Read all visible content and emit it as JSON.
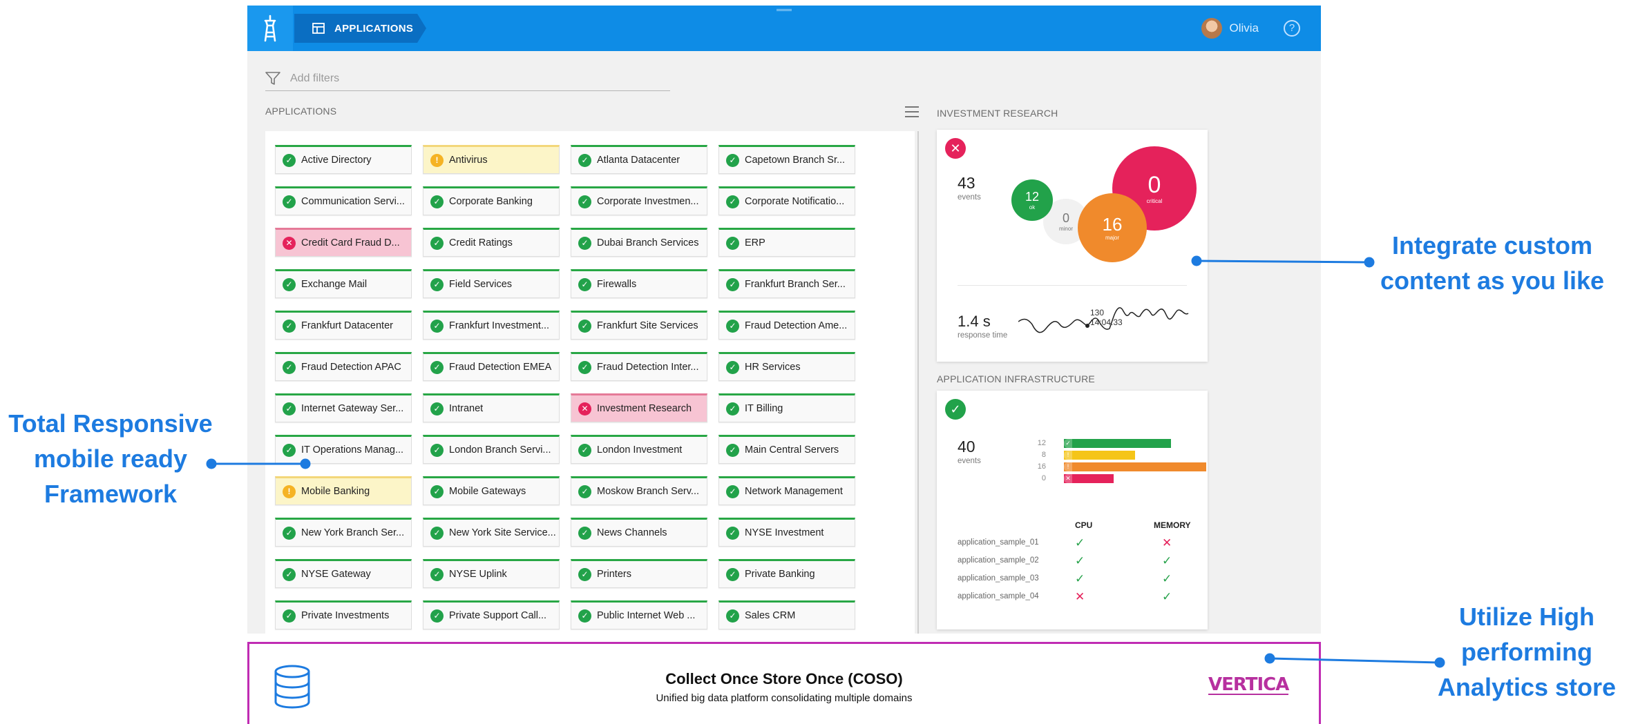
{
  "header": {
    "breadcrumb": "APPLICATIONS",
    "user_name": "Olivia",
    "help_glyph": "?"
  },
  "filter": {
    "placeholder": "Add filters"
  },
  "applications": {
    "title": "APPLICATIONS",
    "tiles": [
      {
        "label": "Active Directory",
        "status": "ok"
      },
      {
        "label": "Antivirus",
        "status": "warn"
      },
      {
        "label": "Atlanta Datacenter",
        "status": "ok"
      },
      {
        "label": "Capetown Branch Sr...",
        "status": "ok"
      },
      {
        "label": "Communication Servi...",
        "status": "ok"
      },
      {
        "label": "Corporate Banking",
        "status": "ok"
      },
      {
        "label": "Corporate Investmen...",
        "status": "ok"
      },
      {
        "label": "Corporate Notificatio...",
        "status": "ok"
      },
      {
        "label": "Credit Card Fraud D...",
        "status": "crit"
      },
      {
        "label": "Credit Ratings",
        "status": "ok"
      },
      {
        "label": "Dubai Branch Services",
        "status": "ok"
      },
      {
        "label": "ERP",
        "status": "ok"
      },
      {
        "label": "Exchange Mail",
        "status": "ok"
      },
      {
        "label": "Field Services",
        "status": "ok"
      },
      {
        "label": "Firewalls",
        "status": "ok"
      },
      {
        "label": "Frankfurt Branch Ser...",
        "status": "ok"
      },
      {
        "label": "Frankfurt Datacenter",
        "status": "ok"
      },
      {
        "label": "Frankfurt Investment...",
        "status": "ok"
      },
      {
        "label": "Frankfurt Site Services",
        "status": "ok"
      },
      {
        "label": "Fraud Detection Ame...",
        "status": "ok"
      },
      {
        "label": "Fraud Detection APAC",
        "status": "ok"
      },
      {
        "label": "Fraud Detection EMEA",
        "status": "ok"
      },
      {
        "label": "Fraud Detection Inter...",
        "status": "ok"
      },
      {
        "label": "HR Services",
        "status": "ok"
      },
      {
        "label": "Internet Gateway Ser...",
        "status": "ok"
      },
      {
        "label": "Intranet",
        "status": "ok"
      },
      {
        "label": "Investment Research",
        "status": "crit"
      },
      {
        "label": "IT Billing",
        "status": "ok"
      },
      {
        "label": "IT Operations Manag...",
        "status": "ok"
      },
      {
        "label": "London Branch Servi...",
        "status": "ok"
      },
      {
        "label": "London Investment",
        "status": "ok"
      },
      {
        "label": "Main Central Servers",
        "status": "ok"
      },
      {
        "label": "Mobile Banking",
        "status": "warn"
      },
      {
        "label": "Mobile Gateways",
        "status": "ok"
      },
      {
        "label": "Moskow Branch Serv...",
        "status": "ok"
      },
      {
        "label": "Network Management",
        "status": "ok"
      },
      {
        "label": "New York Branch Ser...",
        "status": "ok"
      },
      {
        "label": "New York Site Service...",
        "status": "ok"
      },
      {
        "label": "News Channels",
        "status": "ok"
      },
      {
        "label": "NYSE Investment",
        "status": "ok"
      },
      {
        "label": "NYSE Gateway",
        "status": "ok"
      },
      {
        "label": "NYSE Uplink",
        "status": "ok"
      },
      {
        "label": "Printers",
        "status": "ok"
      },
      {
        "label": "Private Banking",
        "status": "ok"
      },
      {
        "label": "Private Investments",
        "status": "ok"
      },
      {
        "label": "Private Support Call...",
        "status": "ok"
      },
      {
        "label": "Public Internet Web ...",
        "status": "ok"
      },
      {
        "label": "Sales CRM",
        "status": "ok"
      }
    ]
  },
  "investment_research": {
    "title": "INVESTMENT RESEARCH",
    "events_count": "43",
    "events_label": "events",
    "bubbles": {
      "ok": {
        "value": "12",
        "label": "ok"
      },
      "minor": {
        "value": "0",
        "label": "minor"
      },
      "major": {
        "value": "16",
        "label": "major"
      },
      "critical": {
        "value": "0",
        "label": "critical"
      }
    },
    "response_time": "1.4 s",
    "response_label": "response time",
    "sparkline_tooltip_value": "130",
    "sparkline_tooltip_time": "14:04:33"
  },
  "application_infrastructure": {
    "title": "APPLICATION INFRASTRUCTURE",
    "events_count": "40",
    "events_label": "events",
    "bars": [
      {
        "count": "12",
        "value": 12,
        "status": "ok",
        "color": "#22a24a"
      },
      {
        "count": "8",
        "value": 8,
        "status": "warn",
        "color": "#f5c518"
      },
      {
        "count": "16",
        "value": 16,
        "status": "major",
        "color": "#f08a2c"
      },
      {
        "count": "0",
        "value": 0,
        "status": "critical",
        "color": "#e5225b"
      }
    ],
    "metrics_headers": {
      "cpu": "CPU",
      "memory": "MEMORY"
    },
    "metrics": [
      {
        "name": "application_sample_01",
        "cpu": "ok",
        "memory": "bad"
      },
      {
        "name": "application_sample_02",
        "cpu": "ok",
        "memory": "ok"
      },
      {
        "name": "application_sample_03",
        "cpu": "ok",
        "memory": "ok"
      },
      {
        "name": "application_sample_04",
        "cpu": "bad",
        "memory": "ok"
      }
    ]
  },
  "banner": {
    "title": "Collect Once Store Once (COSO)",
    "subtitle": "Unified big data platform consolidating multiple domains",
    "logo_text": "VERTICA"
  },
  "callouts": {
    "right_top": [
      "Integrate custom",
      "content as you like"
    ],
    "left": [
      "Total Responsive",
      "mobile ready",
      "Framework"
    ],
    "right_bottom": [
      "Utilize High",
      "performing",
      "Analytics store"
    ]
  },
  "colors": {
    "topbar": "#0e8ce6",
    "ok": "#22a24a",
    "warn": "#f5b324",
    "critical": "#e5225b",
    "major": "#f08a2c",
    "callout": "#1d7be0",
    "banner_border": "#c02cb3"
  }
}
